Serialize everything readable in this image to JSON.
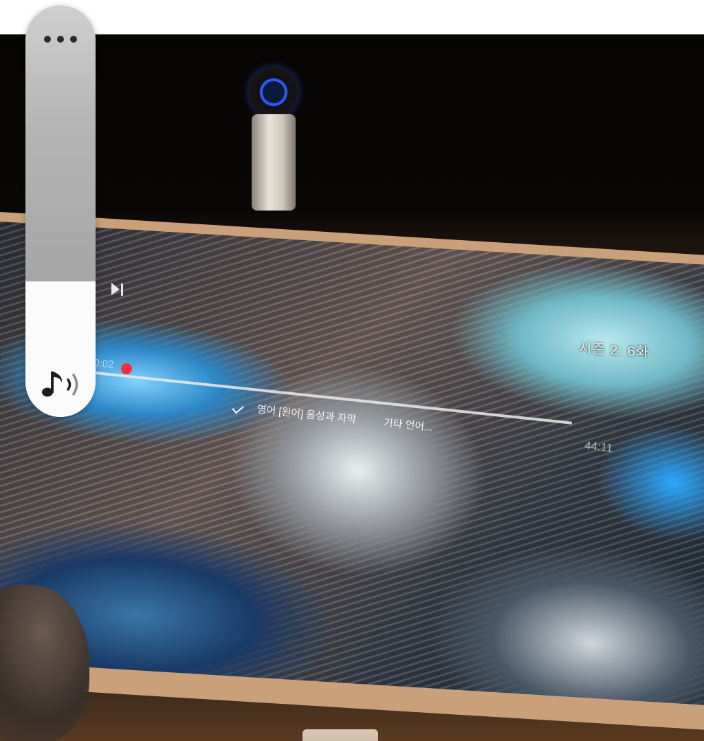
{
  "video_overlay": {
    "episode_label": "시즌 2: 6화",
    "current_time": "00:02",
    "total_time": "44:11",
    "audio_selected": "영어 [원어] 음성과 자막",
    "audio_other": "기타 언어..."
  },
  "volume": {
    "level": 0.33,
    "more_icon": "more-dots-icon",
    "sound_icon": "music-note-volume-icon"
  },
  "colors": {
    "scrubber": "#ff2a3d",
    "panel_fill": "#fbfbfb",
    "panel_track": "#b4b4b4"
  }
}
